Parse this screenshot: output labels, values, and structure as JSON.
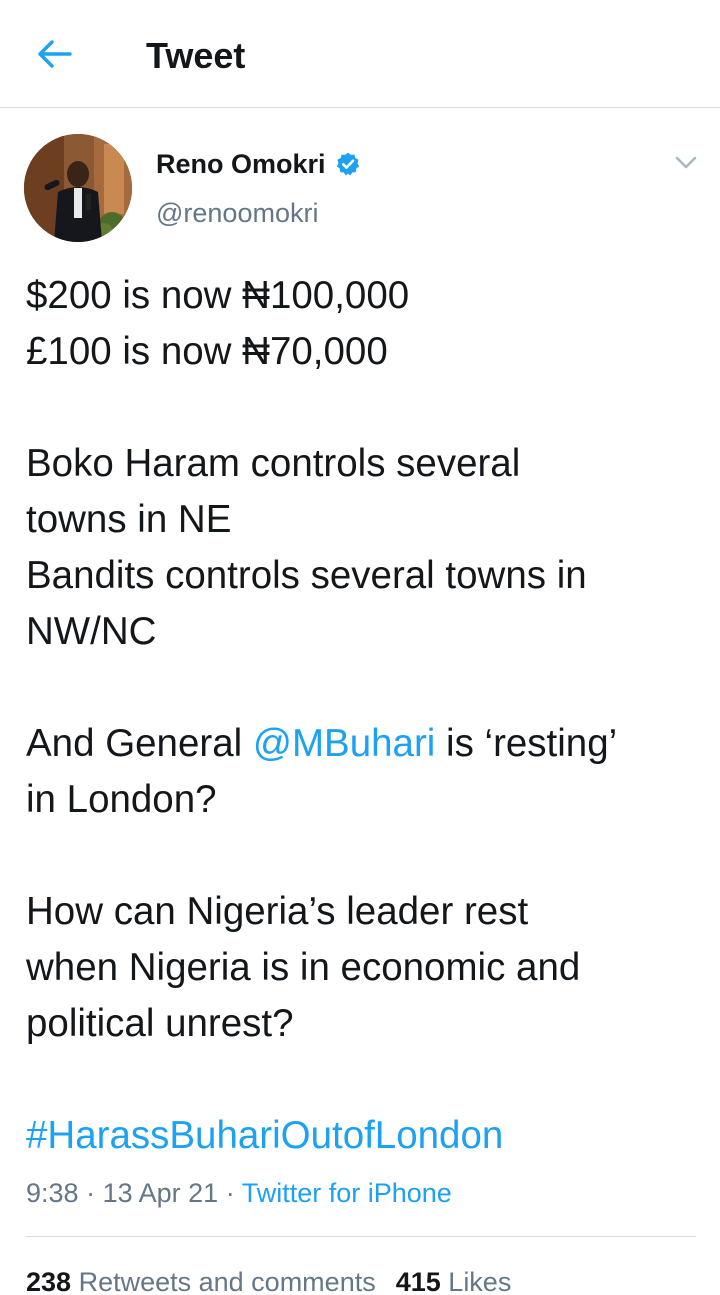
{
  "header": {
    "title": "Tweet",
    "back_icon": "arrow-left-icon"
  },
  "author": {
    "name": "Reno Omokri",
    "handle": "@renoomokri",
    "verified": true
  },
  "tweet": {
    "lines": [
      "$200 is now ₦100,000",
      "£100 is now ₦70,000",
      "",
      "Boko Haram controls several",
      "towns in NE",
      "Bandits controls several towns in",
      "NW/NC",
      "",
      "And General ",
      "in London?",
      "",
      "How can Nigeria’s leader rest",
      "when Nigeria is in economic and",
      "political unrest?",
      ""
    ],
    "mention": "@MBuhari",
    "after_mention": " is ‘resting’",
    "hashtag": "#HarassBuhariOutofLondon"
  },
  "meta": {
    "time": "9:38",
    "date": "13 Apr 21",
    "separator": "·",
    "source": "Twitter for iPhone"
  },
  "stats": {
    "retweets_count": "238",
    "retweets_label": "Retweets and comments",
    "likes_count": "415",
    "likes_label": "Likes"
  },
  "colors": {
    "accent": "#1da1f2",
    "text": "#14171a",
    "secondary": "#657786",
    "divider": "#d9dde1"
  }
}
